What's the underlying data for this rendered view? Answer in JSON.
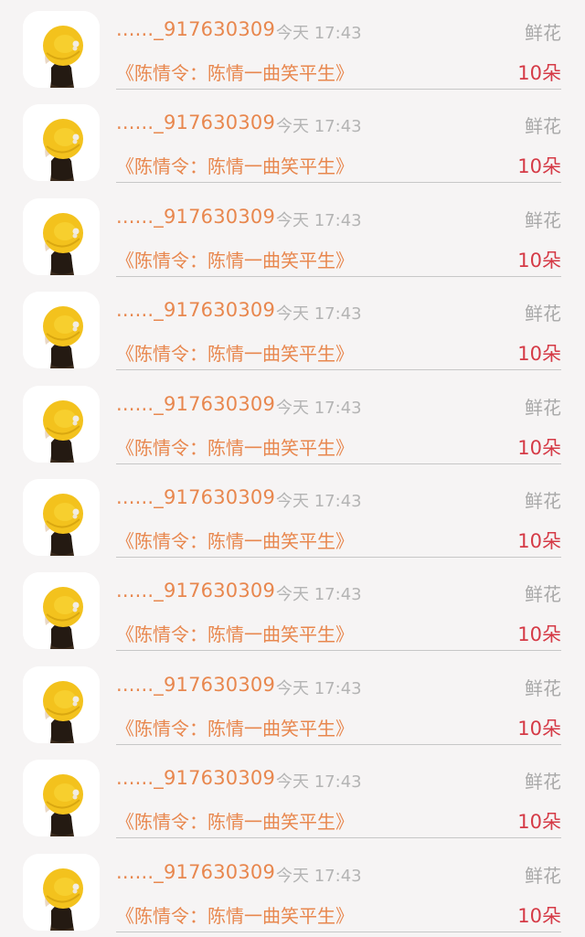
{
  "colors": {
    "accent_orange": "#e8874e",
    "count_red": "#d53a46",
    "muted_gray": "#a8a8a8",
    "background": "#f6f4f4"
  },
  "rows": [
    {
      "avatar_icon": "girl-yellow-hat-avatar",
      "username": "......_917630309",
      "time": "今天 17:43",
      "gift_type": "鲜花",
      "book_title": "《陈情令：陈情一曲笑平生》",
      "gift_count": "10朵"
    },
    {
      "avatar_icon": "girl-yellow-hat-avatar",
      "username": "......_917630309",
      "time": "今天 17:43",
      "gift_type": "鲜花",
      "book_title": "《陈情令：陈情一曲笑平生》",
      "gift_count": "10朵"
    },
    {
      "avatar_icon": "girl-yellow-hat-avatar",
      "username": "......_917630309",
      "time": "今天 17:43",
      "gift_type": "鲜花",
      "book_title": "《陈情令：陈情一曲笑平生》",
      "gift_count": "10朵"
    },
    {
      "avatar_icon": "girl-yellow-hat-avatar",
      "username": "......_917630309",
      "time": "今天 17:43",
      "gift_type": "鲜花",
      "book_title": "《陈情令：陈情一曲笑平生》",
      "gift_count": "10朵"
    },
    {
      "avatar_icon": "girl-yellow-hat-avatar",
      "username": "......_917630309",
      "time": "今天 17:43",
      "gift_type": "鲜花",
      "book_title": "《陈情令：陈情一曲笑平生》",
      "gift_count": "10朵"
    },
    {
      "avatar_icon": "girl-yellow-hat-avatar",
      "username": "......_917630309",
      "time": "今天 17:43",
      "gift_type": "鲜花",
      "book_title": "《陈情令：陈情一曲笑平生》",
      "gift_count": "10朵"
    },
    {
      "avatar_icon": "girl-yellow-hat-avatar",
      "username": "......_917630309",
      "time": "今天 17:43",
      "gift_type": "鲜花",
      "book_title": "《陈情令：陈情一曲笑平生》",
      "gift_count": "10朵"
    },
    {
      "avatar_icon": "girl-yellow-hat-avatar",
      "username": "......_917630309",
      "time": "今天 17:43",
      "gift_type": "鲜花",
      "book_title": "《陈情令：陈情一曲笑平生》",
      "gift_count": "10朵"
    },
    {
      "avatar_icon": "girl-yellow-hat-avatar",
      "username": "......_917630309",
      "time": "今天 17:43",
      "gift_type": "鲜花",
      "book_title": "《陈情令：陈情一曲笑平生》",
      "gift_count": "10朵"
    },
    {
      "avatar_icon": "girl-yellow-hat-avatar",
      "username": "......_917630309",
      "time": "今天 17:43",
      "gift_type": "鲜花",
      "book_title": "《陈情令：陈情一曲笑平生》",
      "gift_count": "10朵"
    }
  ]
}
